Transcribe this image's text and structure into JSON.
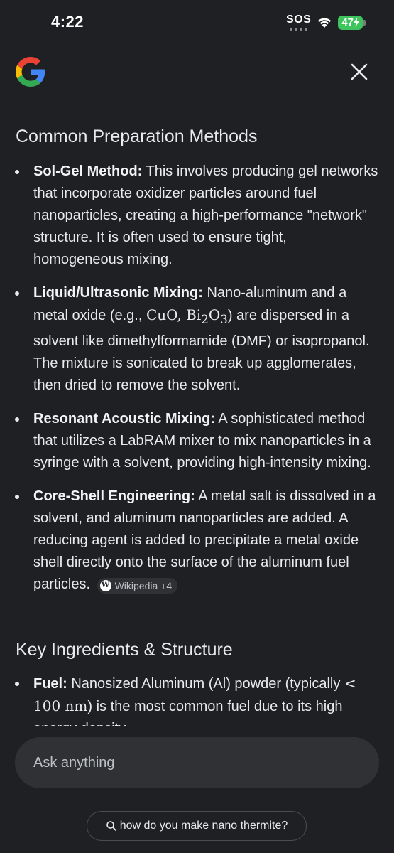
{
  "status_bar": {
    "time": "4:22",
    "sos": "SOS",
    "battery": "47"
  },
  "header": {
    "logo_icon": "google-g-icon",
    "close_icon": "close-icon"
  },
  "sections": [
    {
      "heading": "Common Preparation Methods",
      "items": [
        {
          "term": "Sol-Gel Method:",
          "text": " This involves producing gel networks that incorporate oxidizer particles around fuel nanoparticles, creating a high-performance \"network\" structure. It is often used to ensure tight, homogeneous mixing."
        },
        {
          "term": "Liquid/Ultrasonic Mixing:",
          "text_a": " Nano-aluminum and a metal oxide (e.g., ",
          "math1": "CuO",
          "comma": ", ",
          "math2_base": "Bi",
          "math2_sub1": "2",
          "math2_mid": "O",
          "math2_sub2": "3",
          "text_b": ") are dispersed in a solvent like dimethylformamide (DMF) or isopropanol. The mixture is sonicated to break up agglomerates, then dried to remove the solvent."
        },
        {
          "term": "Resonant Acoustic Mixing:",
          "text": " A sophisticated method that utilizes a LabRAM mixer to mix nanoparticles in a syringe with a solvent, providing high-intensity mixing."
        },
        {
          "term": "Core-Shell Engineering:",
          "text": " A metal salt is dissolved in a solvent, and aluminum nanoparticles are added. A reducing agent is added to precipitate a metal oxide shell directly onto the surface of the aluminum fuel particles.",
          "source_icon_letter": "W",
          "source_label": "Wikipedia +4"
        }
      ]
    },
    {
      "heading": "Key Ingredients & Structure",
      "items": [
        {
          "term": "Fuel:",
          "text_a": " Nanosized Aluminum (Al) powder (typically ",
          "math": "< 100 nm",
          "text_b": ") is the most common fuel due to its high energy density."
        }
      ]
    }
  ],
  "ask_box": {
    "placeholder": "Ask anything"
  },
  "query_pill": {
    "icon": "search-icon",
    "text": "how do you make nano thermite?"
  },
  "colors": {
    "background": "#1f2023",
    "surface": "#303134",
    "battery": "#3ec45c"
  }
}
